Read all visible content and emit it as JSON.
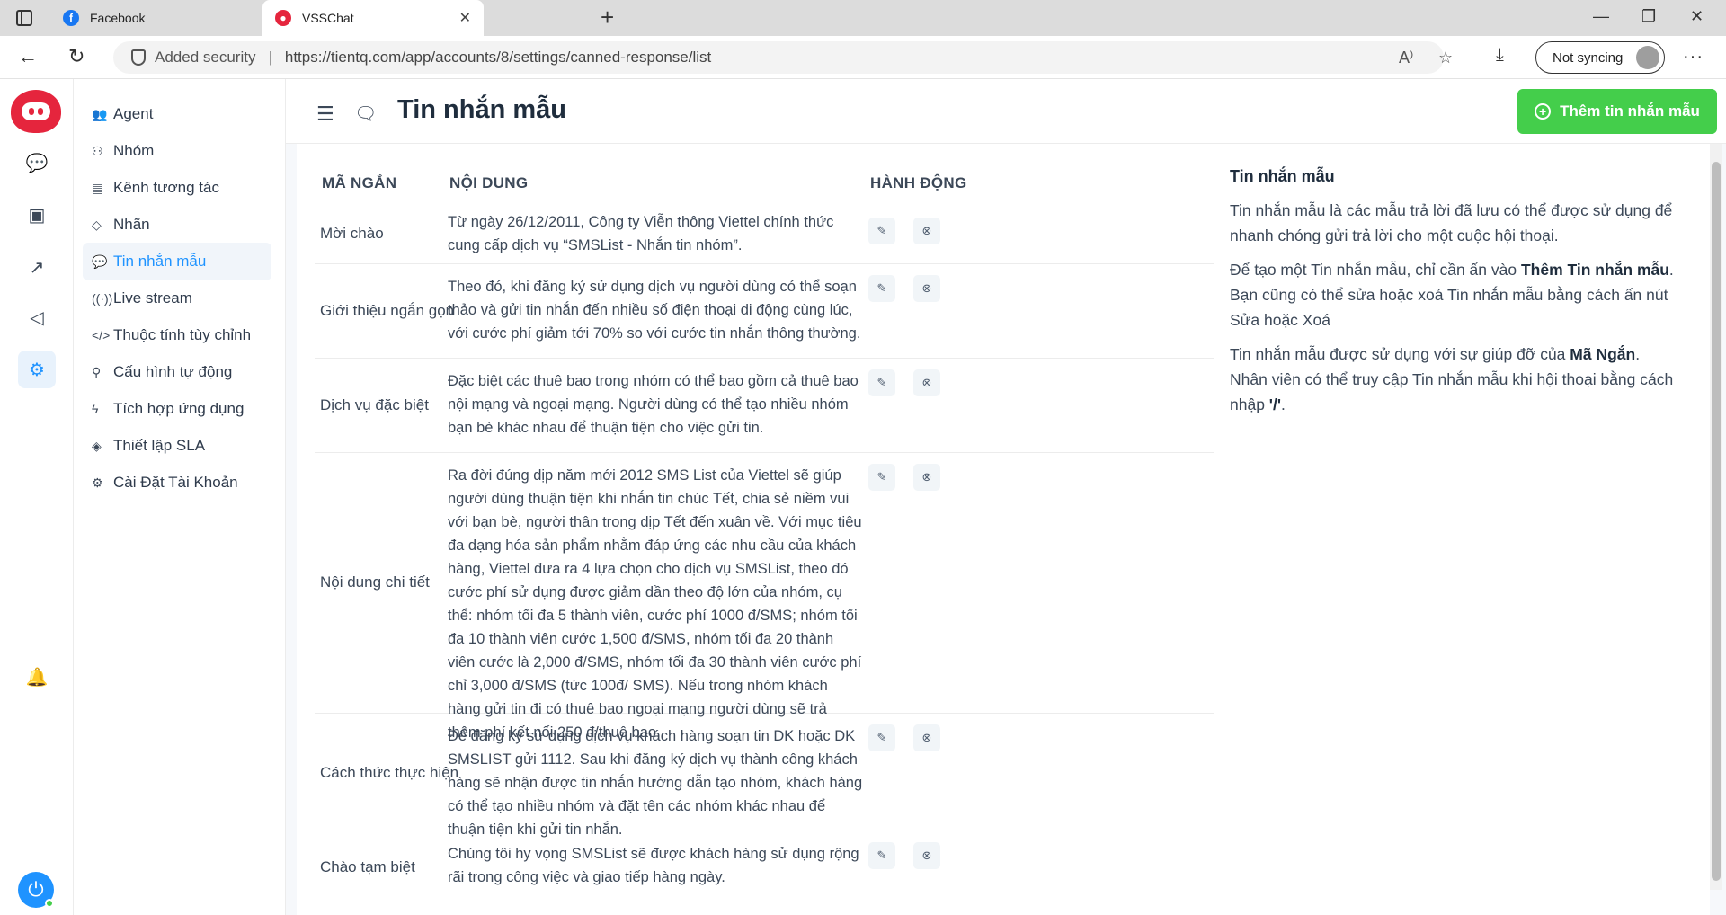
{
  "browser": {
    "tabs": [
      {
        "title": "Facebook",
        "favicon": "facebook-icon"
      },
      {
        "title": "VSSChat",
        "favicon": "vsschat-icon"
      }
    ],
    "security_label": "Added security",
    "url": "https://tientq.com/app/accounts/8/settings/canned-response/list",
    "sync_label": "Not syncing"
  },
  "sidebar": {
    "items": [
      {
        "label": "Agent",
        "icon": "agents-icon"
      },
      {
        "label": "Nhóm",
        "icon": "teams-icon"
      },
      {
        "label": "Kênh tương tác",
        "icon": "inbox-icon"
      },
      {
        "label": "Nhãn",
        "icon": "tag-icon"
      },
      {
        "label": "Tin nhắn mẫu",
        "icon": "chat-bubbles-icon",
        "active": true
      },
      {
        "label": "Live stream",
        "icon": "broadcast-icon"
      },
      {
        "label": "Thuộc tính tùy chỉnh",
        "icon": "code-icon"
      },
      {
        "label": "Cấu hình tự động",
        "icon": "automation-icon"
      },
      {
        "label": "Tích hợp ứng dụng",
        "icon": "flash-icon"
      },
      {
        "label": "Thiết lập SLA",
        "icon": "sla-icon"
      },
      {
        "label": "Cài Đặt Tài Khoản",
        "icon": "settings-icon"
      }
    ]
  },
  "header": {
    "title": "Tin nhắn mẫu",
    "add_button": "Thêm tin nhắn mẫu"
  },
  "table": {
    "headers": {
      "code": "MÃ NGẮN",
      "content": "NỘI DUNG",
      "actions": "HÀNH ĐỘNG"
    },
    "rows": [
      {
        "code": "Mời chào",
        "content": "Từ ngày 26/12/2011, Công ty Viễn thông Viettel chính thức cung cấp dịch vụ “SMSList - Nhắn tin nhóm”."
      },
      {
        "code": "Giới thiệu ngắn gọn",
        "content": "Theo đó, khi đăng ký sử dụng dịch vụ người dùng có thể soạn thảo và gửi tin nhắn đến nhiều số điện thoại di động cùng lúc, với cước phí giảm tới 70% so với cước tin nhắn thông thường."
      },
      {
        "code": "Dịch vụ đặc biệt",
        "content": "Đặc biệt các thuê bao trong nhóm có thể bao gồm cả thuê bao nội mạng và ngoại mạng. Người dùng có thể tạo nhiều nhóm bạn bè khác nhau để thuận tiện cho việc gửi tin."
      },
      {
        "code": "Nội dung chi tiết",
        "content": "Ra đời đúng dịp năm mới 2012 SMS List của Viettel sẽ giúp người dùng thuận tiện khi nhắn tin chúc Tết, chia sẻ niềm vui với bạn bè, người thân trong dịp Tết đến xuân về. Với mục tiêu đa dạng hóa sản phẩm nhằm đáp ứng các nhu cầu của khách hàng, Viettel đưa ra 4 lựa chọn cho dịch vụ SMSList, theo đó cước phí sử dụng được giảm dần theo độ lớn của nhóm, cụ thể: nhóm tối đa 5 thành viên, cước phí 1000 đ/SMS; nhóm tối đa 10 thành viên cước 1,500 đ/SMS, nhóm tối đa 20 thành viên cước là 2,000 đ/SMS, nhóm tối đa 30 thành viên cước phí chỉ 3,000 đ/SMS (tức 100đ/ SMS). Nếu trong nhóm khách hàng gửi tin đi có thuê bao ngoại mạng người dùng sẽ trả thêm phí kết nối 250 đ/thuê bao."
      },
      {
        "code": "Cách thức thực hiện",
        "content": "Để đăng ký sử dụng dịch vụ khách hàng soạn tin DK hoặc DK SMSLIST gửi 1112. Sau khi đăng ký dịch vụ thành công khách hàng sẽ nhận được tin nhắn hướng dẫn tạo nhóm, khách hàng có thể tạo nhiều nhóm và đặt tên các nhóm khác nhau để thuận tiện khi gửi tin nhắn."
      },
      {
        "code": "Chào tạm biệt",
        "content": "Chúng tôi hy vọng SMSList sẽ được khách hàng sử dụng rộng rãi trong công việc và giao tiếp hàng ngày."
      }
    ]
  },
  "info": {
    "title": "Tin nhắn mẫu",
    "p1": "Tin nhắn mẫu là các mẫu trả lời đã lưu có thể được sử dụng để nhanh chóng gửi trả lời cho một cuộc hội thoại.",
    "p2_a": "Để tạo một Tin nhắn mẫu, chỉ cần ấn vào ",
    "p2_b": "Thêm Tin nhắn mẫu",
    "p2_c": ". Bạn cũng có thể sửa hoặc xoá Tin nhắn mẫu bằng cách ấn nút Sửa hoặc Xoá",
    "p3_a": "Tin nhắn mẫu được sử dụng với sự giúp đỡ của ",
    "p3_b": "Mã Ngắn",
    "p3_c": ". Nhân viên có thể truy cập Tin nhắn mẫu khi hội thoại bằng cách nhập ",
    "p3_d": "'/'",
    "p3_e": "."
  }
}
